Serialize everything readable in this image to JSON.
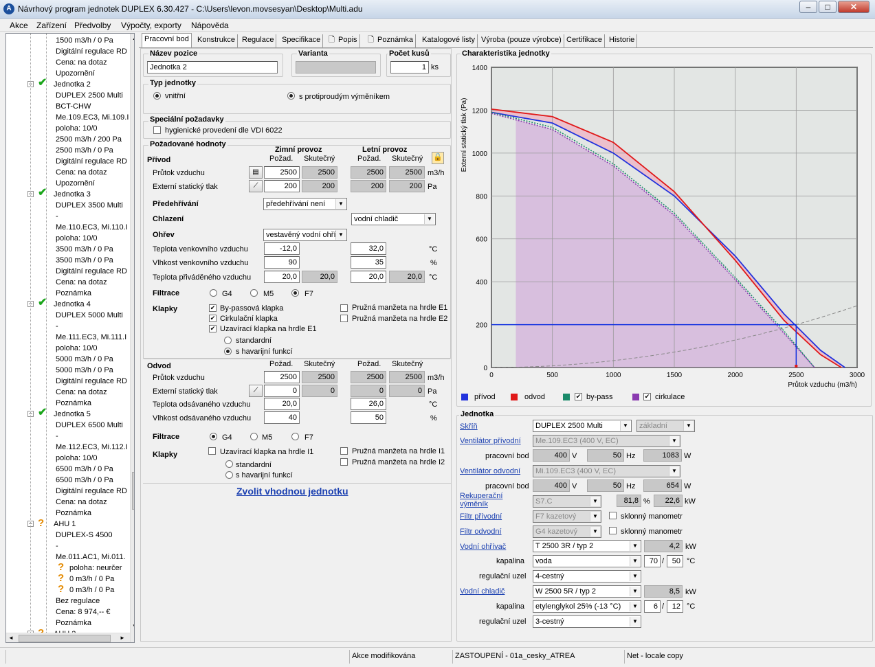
{
  "window": {
    "title": "Návrhový program jednotek DUPLEX 6.30.427 - C:\\Users\\levon.movsesyan\\Desktop\\Multi.adu"
  },
  "menu": [
    "Akce",
    "Zařízení",
    "Předvolby",
    "Výpočty, exporty",
    "Nápověda"
  ],
  "tree": [
    {
      "text": "1500 m3/h / 0 Pa"
    },
    {
      "text": "Digitální regulace RD"
    },
    {
      "text": "Cena: na dotaz"
    },
    {
      "text": "Upozornění"
    },
    {
      "text": "Jednotka 2"
    },
    {
      "text": "DUPLEX 2500 Multi"
    },
    {
      "text": "BCT-CHW"
    },
    {
      "text": "Me.109.EC3, Mi.109.I"
    },
    {
      "text": "poloha: 10/0"
    },
    {
      "text": "2500 m3/h / 200 Pa"
    },
    {
      "text": "2500 m3/h / 0 Pa"
    },
    {
      "text": "Digitální regulace RD"
    },
    {
      "text": "Cena: na dotaz"
    },
    {
      "text": "Upozornění"
    },
    {
      "text": "Jednotka 3"
    },
    {
      "text": "DUPLEX 3500 Multi"
    },
    {
      "text": "-"
    },
    {
      "text": "Me.110.EC3, Mi.110.I"
    },
    {
      "text": "poloha: 10/0"
    },
    {
      "text": "3500 m3/h / 0 Pa"
    },
    {
      "text": "3500 m3/h / 0 Pa"
    },
    {
      "text": "Digitální regulace RD"
    },
    {
      "text": "Cena: na dotaz"
    },
    {
      "text": "Poznámka"
    },
    {
      "text": "Jednotka 4"
    },
    {
      "text": "DUPLEX 5000 Multi"
    },
    {
      "text": "-"
    },
    {
      "text": "Me.111.EC3, Mi.111.I"
    },
    {
      "text": "poloha: 10/0"
    },
    {
      "text": "5000 m3/h / 0 Pa"
    },
    {
      "text": "5000 m3/h / 0 Pa"
    },
    {
      "text": "Digitální regulace RD"
    },
    {
      "text": "Cena: na dotaz"
    },
    {
      "text": "Poznámka"
    },
    {
      "text": "Jednotka 5"
    },
    {
      "text": "DUPLEX 6500 Multi"
    },
    {
      "text": "-"
    },
    {
      "text": "Me.112.EC3, Mi.112.I"
    },
    {
      "text": "poloha: 10/0"
    },
    {
      "text": "6500 m3/h / 0 Pa"
    },
    {
      "text": "6500 m3/h / 0 Pa"
    },
    {
      "text": "Digitální regulace RD"
    },
    {
      "text": "Cena: na dotaz"
    },
    {
      "text": "Poznámka"
    },
    {
      "text": "AHU 1"
    },
    {
      "text": "DUPLEX-S 4500"
    },
    {
      "text": "-"
    },
    {
      "text": "Me.011.AC1, Mi.011."
    },
    {
      "text": "poloha:  neurčer"
    },
    {
      "text": "0 m3/h / 0 Pa"
    },
    {
      "text": "0 m3/h / 0 Pa"
    },
    {
      "text": "Bez regulace"
    },
    {
      "text": "Cena: 8 974,-- €"
    },
    {
      "text": "Poznámka"
    },
    {
      "text": "AHU 2"
    }
  ],
  "tabs": [
    "Pracovní bod",
    "Konstrukce",
    "Regulace",
    "Specifikace",
    "Popis",
    "Poznámka",
    "Katalogové listy",
    "Výroba (pouze výrobce)",
    "Certifikace",
    "Historie"
  ],
  "form": {
    "nazev_pozice": {
      "title": "Název pozice",
      "value": "Jednotka 2"
    },
    "varianta": {
      "title": "Varianta",
      "value": ""
    },
    "pocet_kusu": {
      "title": "Počet kusů",
      "value": "1",
      "unit": "ks"
    },
    "typ": {
      "title": "Typ jednotky",
      "opt1": "vnitřní",
      "opt2": "s protiproudým výměníkem"
    },
    "spec": {
      "title": "Speciální požadavky",
      "hyg": "hygienické provedení dle VDI 6022"
    },
    "poz": {
      "title": "Požadované hodnoty",
      "zimni": "Zimní provoz",
      "letni": "Letní provoz",
      "pozad": "Požad.",
      "skut": "Skutečný",
      "privod": "Přívod",
      "odvod": "Odvod",
      "prutok": "Průtok vzduchu",
      "ext_tlak": "Externí statický tlak",
      "predehrivani": "Předehřívání",
      "predehrivani_val": "předehřívání není",
      "chlazeni": "Chlazení",
      "chlazeni_val": "vodní chladič",
      "ohrev": "Ohřev",
      "ohrev_val": "vestavěný vodní ohří",
      "t_venk": "Teplota venkovního vzduchu",
      "vlh_venk": "Vlhkost venkovního vzduchu",
      "t_prived": "Teplota přiváděného vzduchu",
      "t_odsav": "Teplota odsávaného vzduchu",
      "vlh_odsav": "Vlhkost odsávaného vzduchu",
      "filtrace": "Filtrace",
      "klapky": "Klapky",
      "g4": "G4",
      "m5": "M5",
      "f7": "F7",
      "bypass": "By-passová klapka",
      "cirk": "Cirkulační klapka",
      "uzav_e1": "Uzavírací klapka na hrdle E1",
      "standardni": "standardní",
      "havar": "s havarijní funkcí",
      "pruz_e1": "Pružná manžeta na hrdle E1",
      "pruz_e2": "Pružná manžeta na hrdle E2",
      "uzav_i1": "Uzavírací klapka na hrdle I1",
      "pruz_i1": "Pružná manžeta na hrdle I1",
      "pruz_i2": "Pružná manžeta na hrdle I2",
      "u_m3h": "m3/h",
      "u_pa": "Pa",
      "u_c": "°C",
      "u_pct": "%",
      "p_prutok": [
        "2500",
        "2500",
        "2500",
        "2500"
      ],
      "p_tlak": [
        "200",
        "200",
        "200",
        "200"
      ],
      "t_venk_v": [
        "-12,0",
        "32,0"
      ],
      "vlh_venk_v": [
        "90",
        "35"
      ],
      "t_prived_v": [
        "20,0",
        "20,0",
        "20,0",
        "20,0"
      ],
      "o_prutok": [
        "2500",
        "2500",
        "2500",
        "2500"
      ],
      "o_tlak": [
        "0",
        "0",
        "0",
        "0"
      ],
      "t_odsav_v": [
        "20,0",
        "26,0"
      ],
      "vlh_odsav_v": [
        "40",
        "50"
      ]
    },
    "zvolit": "Zvolit vhodnou jednotku"
  },
  "chart": {
    "title": "Charakteristika jednotky",
    "legend": {
      "privod": "přívod",
      "odvod": "odvod",
      "bypass": "by-pass",
      "cirkulace": "cirkulace"
    },
    "colors": {
      "privod": "#2233dd",
      "odvod": "#e01818",
      "bypass": "#1a8a6a",
      "cirkulace": "#8a3ab0"
    }
  },
  "chart_data": {
    "type": "line",
    "title": "Charakteristika jednotky",
    "xlabel": "Průtok vzduchu (m3/h)",
    "ylabel": "Externí statický tlak (Pa)",
    "xlim": [
      0,
      3000
    ],
    "ylim": [
      0,
      1400
    ],
    "xticks": [
      0,
      500,
      1000,
      1500,
      2000,
      2500,
      3000
    ],
    "yticks": [
      0,
      200,
      400,
      600,
      800,
      1000,
      1200,
      1400
    ],
    "grid": true,
    "legend_position": "bottom",
    "series": [
      {
        "name": "přívod",
        "color": "#2233dd",
        "x": [
          0,
          500,
          1000,
          1500,
          2000,
          2400,
          2700,
          2900
        ],
        "y": [
          1190,
          1140,
          1000,
          800,
          520,
          250,
          80,
          0
        ]
      },
      {
        "name": "odvod",
        "color": "#e01818",
        "x": [
          0,
          500,
          1000,
          1500,
          2000,
          2400,
          2700,
          2870
        ],
        "y": [
          1205,
          1170,
          1050,
          820,
          500,
          220,
          60,
          0
        ]
      },
      {
        "name": "by-pass",
        "color": "#1a8a6a",
        "x": [
          0,
          500,
          1000,
          1500,
          2000,
          2400,
          2650
        ],
        "y": [
          1190,
          1120,
          950,
          720,
          420,
          170,
          0
        ]
      },
      {
        "name": "cirkulace",
        "color": "#8a3ab0",
        "x": [
          0,
          500,
          1000,
          1500,
          2000,
          2400,
          2650
        ],
        "y": [
          1185,
          1110,
          940,
          710,
          410,
          160,
          0
        ]
      }
    ],
    "working_point": {
      "x": 2500,
      "y": 200
    }
  },
  "unit": {
    "title": "Jednotka",
    "skrin": {
      "label": "Skříň",
      "value": "DUPLEX 2500 Multi",
      "variant": "základní"
    },
    "vent_priv": {
      "label": "Ventilátor přívodní",
      "value": "Me.109.EC3 (400 V, EC)"
    },
    "pracovni_bod": "pracovní bod",
    "vp_bod": [
      "400",
      "50",
      "1083"
    ],
    "vent_odv": {
      "label": "Ventilátor odvodní",
      "value": "Mi.109.EC3 (400 V, EC)"
    },
    "vo_bod": [
      "400",
      "50",
      "654"
    ],
    "rek": {
      "label": "Rekuperační výměník",
      "value": "S7.C",
      "eff": "81,8",
      "kw": "22,6"
    },
    "filtr_priv": {
      "label": "Filtr přívodní",
      "value": "F7 kazetový",
      "mano": "sklonný manometr"
    },
    "filtr_odv": {
      "label": "Filtr odvodní",
      "value": "G4 kazetový",
      "mano": "sklonný manometr"
    },
    "ohrivac": {
      "label": "Vodní ohřívač",
      "value": "T 2500 3R / typ 2",
      "kw": "4,2"
    },
    "kapalina": "kapalina",
    "ohr_kap": {
      "value": "voda",
      "t1": "70",
      "t2": "50"
    },
    "reg_uzel": "regulační uzel",
    "ohr_reg": "4-cestný",
    "chladic": {
      "label": "Vodní chladič",
      "value": "W 2500 5R / typ 2",
      "kw": "8,5"
    },
    "chl_kap": {
      "value": "etylenglykol 25% (-13 °C)",
      "t1": "6",
      "t2": "12"
    },
    "chl_reg": "3-cestný",
    "u_v": "V",
    "u_hz": "Hz",
    "u_w": "W",
    "u_pct": "%",
    "u_kw": "kW",
    "u_c": "°C",
    "slash": "/"
  },
  "status": {
    "s1": "Akce modifikována",
    "s2": "ZASTOUPENÍ - 01a_cesky_ATREA",
    "s3": "Net - locale copy"
  }
}
